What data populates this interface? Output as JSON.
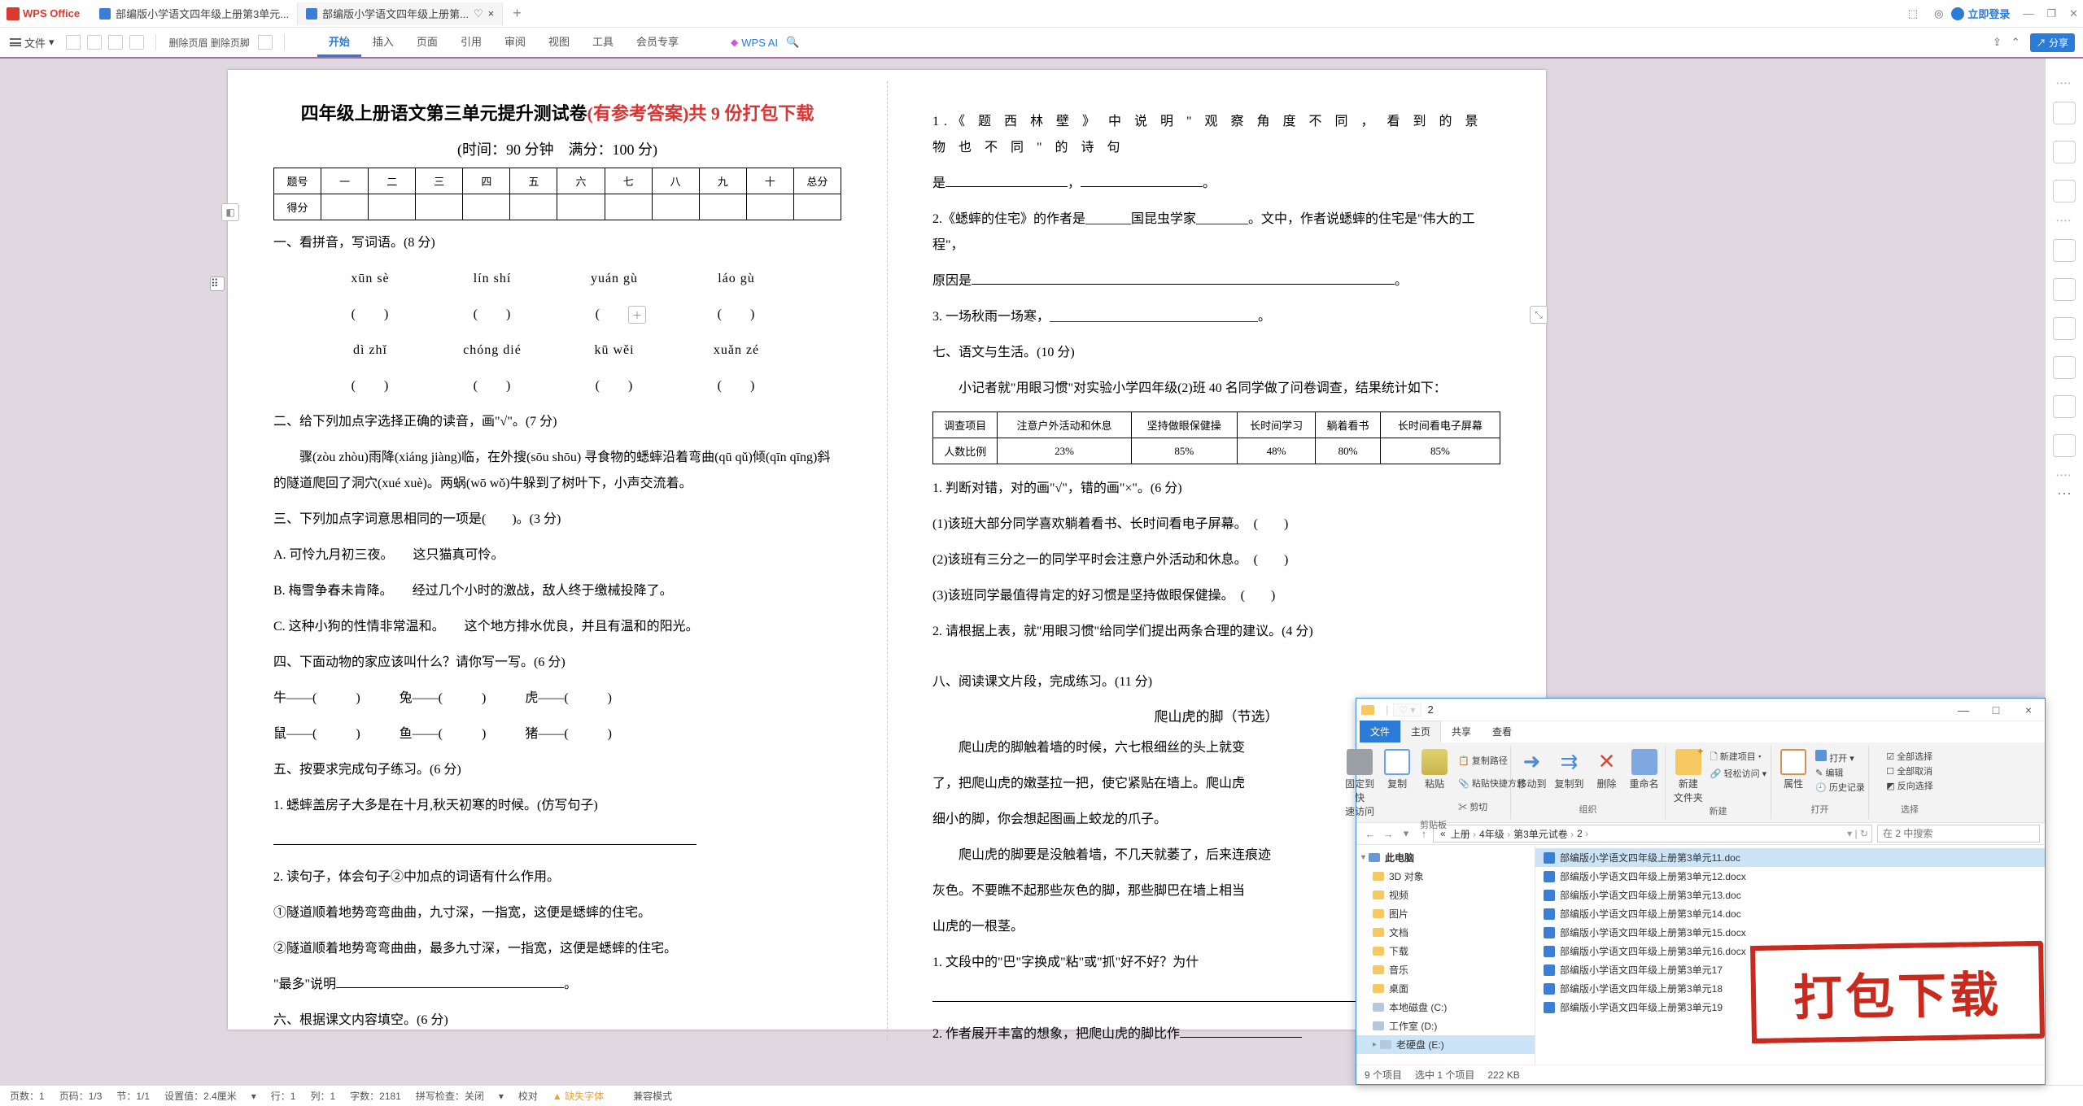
{
  "titlebar": {
    "app_name": "WPS Office",
    "tab1": "部编版小学语文四年级上册第3单元...",
    "tab2": "部编版小学语文四年级上册第...",
    "login": "立即登录"
  },
  "ribbon": {
    "menu": "文件",
    "del_header": "删除页眉  删除页脚",
    "tabs": [
      "开始",
      "插入",
      "页面",
      "引用",
      "审阅",
      "视图",
      "工具",
      "会员专享"
    ],
    "wps_ai": "WPS AI",
    "share": "分享"
  },
  "status": {
    "page": "页数：1",
    "pagepos": "页码：1/3",
    "sec": "节：1/1",
    "scale": "设置值：2.4厘米",
    "row": "行：1",
    "col": "列：1",
    "chars": "字数：2181",
    "spell": "拼写检查：关闭",
    "proof": "校对",
    "missing_font": "缺失字体",
    "compat": "兼容模式"
  },
  "doc": {
    "title_pref": "四年级上册语文第三单元提升测试卷",
    "title_red": "(有参考答案)共 9 份打包下载",
    "subtitle": "(时间：90 分钟　满分：100 分)",
    "score_head": [
      "题号",
      "一",
      "二",
      "三",
      "四",
      "五",
      "六",
      "七",
      "八",
      "九",
      "十",
      "总分"
    ],
    "score_row": "得分",
    "q1": "一、看拼音，写词语。(8 分)",
    "p_row1": [
      "xūn  sè",
      "lín  shí",
      "yuán  gù",
      "láo  gù"
    ],
    "p_row2": [
      "dì  zhǐ",
      "chóng  dié",
      "kū  wěi",
      "xuǎn  zé"
    ],
    "q2": "二、给下列加点字选择正确的读音，画\"√\"。(7 分)",
    "q2a": "骤(zòu zhòu)雨降(xiáng jiàng)临，在外搜(sōu shōu) 寻食物的蟋蟀沿着弯曲(qū qǔ)倾(qīn qīng)斜的隧道爬回了洞穴(xué xuè)。两蜗(wō wǒ)牛躲到了树叶下，小声交流着。",
    "q3": "三、下列加点字词意思相同的一项是(　　)。(3 分)",
    "q3a": "A. 可怜九月初三夜。　　这只猫真可怜。",
    "q3b": "B. 梅雪争春未肯降。　　经过几个小时的激战，敌人终于缴械投降了。",
    "q3c": "C. 这种小狗的性情非常温和。　　这个地方排水优良，并且有温和的阳光。",
    "q4": "四、下面动物的家应该叫什么？请你写一写。(6 分)",
    "q4a": "牛——(　　　)　　　兔——(　　　)　　　虎——(　　　)",
    "q4b": "鼠——(　　　)　　　鱼——(　　　)　　　猪——(　　　)",
    "q5": "五、按要求完成句子练习。(6 分)",
    "q5a": "1. 蟋蟀盖房子大多是在十月,秋天初寒的时候。(仿写句子)",
    "q5b": "2. 读句子，体会句子②中加点的词语有什么作用。",
    "q5c": "①隧道顺着地势弯弯曲曲，九寸深，一指宽，这便是蟋蟀的住宅。",
    "q5d": "②隧道顺着地势弯弯曲曲，最多九寸深，一指宽，这便是蟋蟀的住宅。",
    "q5e": "\"最多\"说明",
    "q6": "六、根据课文内容填空。(6 分)",
    "r1a": "1.《 题 西 林 壁 》 中 说 明 \" 观 察 角 度 不 同 ， 看 到 的 景 物 也 不 同 \" 的 诗 句",
    "r1b": "是",
    "r2a": "2.《蟋蟀的住宅》的作者是_______国昆虫学家________。文中，作者说蟋蟀的住宅是\"伟大的工程\"，",
    "r2b": "原因是",
    "r3": "3. 一场秋雨一场寒，________________________________。",
    "q7": "七、语文与生活。(10 分)",
    "q7a": "小记者就\"用眼习惯\"对实验小学四年级(2)班 40 名同学做了问卷调查，结果统计如下：",
    "survey_head": [
      "调查项目",
      "注意户外活动和休息",
      "坚持做眼保健操",
      "长时间学习",
      "躺着看书",
      "长时间看电子屏幕"
    ],
    "survey_row": [
      "人数比例",
      "23%",
      "85%",
      "48%",
      "80%",
      "85%"
    ],
    "q7b": "1. 判断对错，对的画\"√\"，错的画\"×\"。(6 分)",
    "q7c": "(1)该班大部分同学喜欢躺着看书、长时间看电子屏幕。　(　　)",
    "q7d": "(2)该班有三分之一的同学平时会注意户外活动和休息。　(　　)",
    "q7e": "(3)该班同学最值得肯定的好习惯是坚持做眼保健操。　(　　)",
    "q7f": "2. 请根据上表，就\"用眼习惯\"给同学们提出两条合理的建议。(4 分)",
    "q8": "八、阅读课文片段，完成练习。(11 分)",
    "q8t": "爬山虎的脚（节选）",
    "q8p1": "爬山虎的脚触着墙的时候，六七根细丝的头上就变",
    "q8p2": "了，把爬山虎的嫩茎拉一把，使它紧贴在墙上。爬山虎",
    "q8p3": "细小的脚，你会想起图画上蛟龙的爪子。",
    "q8p4": "爬山虎的脚要是没触着墙，不几天就萎了，后来连痕迹",
    "q8p5": "灰色。不要瞧不起那些灰色的脚，那些脚巴在墙上相当",
    "q8p6": "山虎的一根茎。",
    "q8q1": "1. 文段中的\"巴\"字换成\"粘\"或\"抓\"好不好？为什",
    "q8q2": "2. 作者展开丰富的想象，把爬山虎的脚比作"
  },
  "explorer": {
    "title": "2",
    "fav": "♡ ▾",
    "tabs": [
      "文件",
      "主页",
      "共享",
      "查看"
    ],
    "rb": {
      "pin": "固定到快\n速访问",
      "copy": "复制",
      "paste": "粘贴",
      "copy_path": "复制路径",
      "paste_shortcut": "粘贴快捷方式",
      "cut": "剪切",
      "move": "移动到",
      "copyto": "复制到",
      "del": "删除",
      "rename": "重命名",
      "new_item": "新建项目 ▾",
      "quick_access": "轻松访问 ▾",
      "new_folder": "新建\n文件夹",
      "prop": "属性",
      "open": "打开 ▾",
      "edit": "编辑",
      "history": "历史记录",
      "sel_all": "全部选择",
      "sel_none": "全部取消",
      "sel_inv": "反向选择",
      "g_clip": "剪贴板",
      "g_org": "组织",
      "g_new": "新建",
      "g_open": "打开",
      "g_sel": "选择"
    },
    "path": [
      "上册",
      "4年级",
      "第3单元试卷",
      "2"
    ],
    "search_ph": "在 2 中搜索",
    "tree_main": "此电脑",
    "tree": [
      "3D 对象",
      "视频",
      "图片",
      "文档",
      "下载",
      "音乐",
      "桌面"
    ],
    "drives": [
      "本地磁盘 (C:)",
      "工作室 (D:)",
      "老硬盘 (E:)"
    ],
    "files": [
      "部编版小学语文四年级上册第3单元11.doc",
      "部编版小学语文四年级上册第3单元12.docx",
      "部编版小学语文四年级上册第3单元13.doc",
      "部编版小学语文四年级上册第3单元14.doc",
      "部编版小学语文四年级上册第3单元15.docx",
      "部编版小学语文四年级上册第3单元16.docx",
      "部编版小学语文四年级上册第3单元17",
      "部编版小学语文四年级上册第3单元18",
      "部编版小学语文四年级上册第3单元19"
    ],
    "status_count": "9 个项目",
    "status_sel": "选中 1 个项目",
    "status_size": "222 KB"
  },
  "stamp": "打包下载",
  "chart_data": {
    "type": "table",
    "title": "用眼习惯调查统计",
    "categories": [
      "注意户外活动和休息",
      "坚持做眼保健操",
      "长时间学习",
      "躺着看书",
      "长时间看电子屏幕"
    ],
    "values": [
      23,
      85,
      48,
      80,
      85
    ],
    "ylabel": "人数比例(%)",
    "xlabel": "调查项目"
  }
}
